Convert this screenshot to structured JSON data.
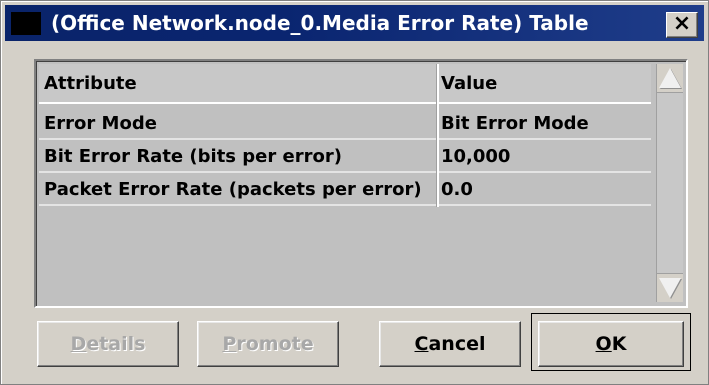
{
  "window": {
    "title": "(Office Network.node_0.Media Error Rate) Table",
    "close_label": "×"
  },
  "table": {
    "headers": {
      "attribute": "Attribute",
      "value": "Value"
    },
    "rows": [
      {
        "attribute": "Error Mode",
        "value": "Bit Error Mode"
      },
      {
        "attribute": "Bit Error Rate (bits per error)",
        "value": "10,000"
      },
      {
        "attribute": "Packet Error Rate (packets per error)",
        "value": "0.0"
      }
    ]
  },
  "buttons": {
    "details": {
      "mnemonic": "D",
      "rest": "etails",
      "enabled": false
    },
    "promote": {
      "mnemonic": "P",
      "rest": "romote",
      "enabled": false
    },
    "cancel": {
      "mnemonic": "C",
      "rest": "ancel",
      "enabled": true
    },
    "ok": {
      "mnemonic": "O",
      "rest": "K",
      "enabled": true
    }
  },
  "colors": {
    "titlebar": "#0a246a",
    "face": "#d4d0c8",
    "disabled_text": "#a8a8a8"
  },
  "icons": {
    "window_icon": "app-window-icon",
    "close": "close-icon",
    "scroll_up": "scroll-up-arrow-icon",
    "scroll_down": "scroll-down-arrow-icon"
  }
}
